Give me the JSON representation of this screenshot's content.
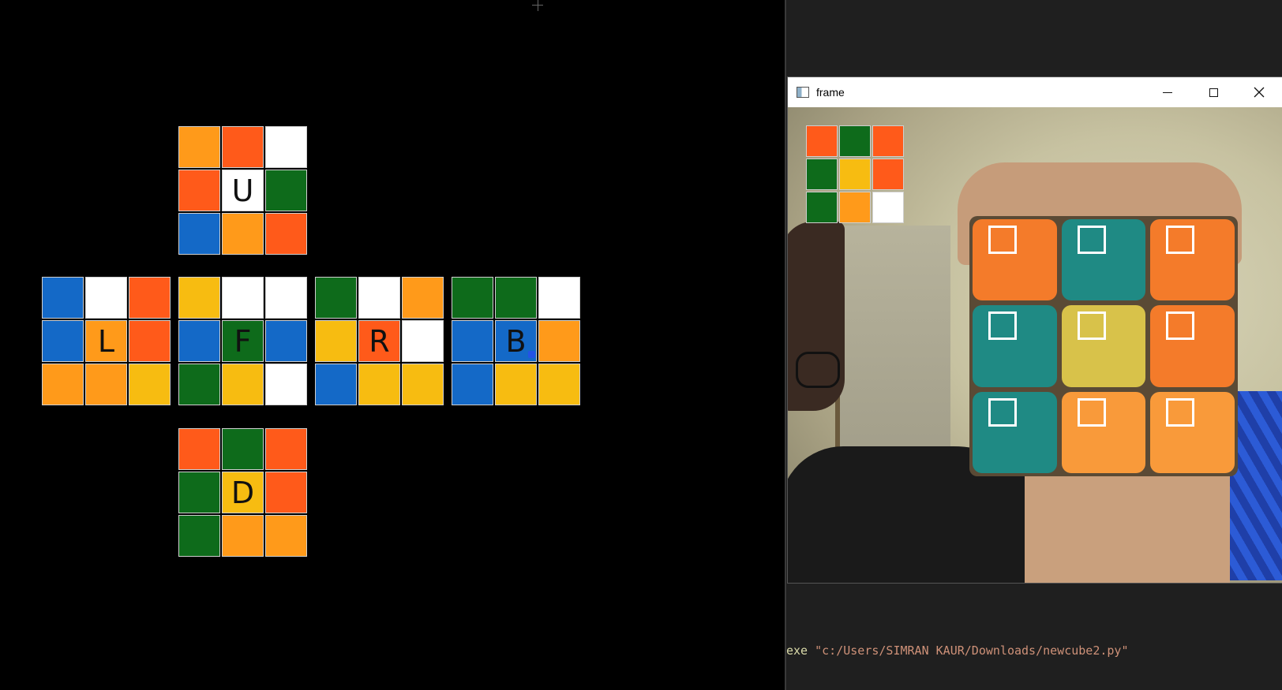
{
  "colors": {
    "orange": "#FF9A1A",
    "red": "#FF5A1A",
    "white": "#FFFFFF",
    "green": "#0E6B1B",
    "blue": "#1469C7",
    "yellow": "#F7BC11",
    "teal": "#1F8A84",
    "cube_orange": "#F47B2A",
    "cube_yellow": "#D8C24A",
    "cube_light_orange": "#F99A3A"
  },
  "net": {
    "faces": [
      {
        "id": "U",
        "letter": "U",
        "stickers": [
          "orange",
          "red",
          "white",
          "red",
          "white",
          "green",
          "blue",
          "orange",
          "red"
        ]
      },
      {
        "id": "L",
        "letter": "L",
        "stickers": [
          "blue",
          "white",
          "red",
          "blue",
          "orange",
          "red",
          "orange",
          "orange",
          "yellow"
        ]
      },
      {
        "id": "F",
        "letter": "F",
        "stickers": [
          "yellow",
          "white",
          "white",
          "blue",
          "green",
          "blue",
          "green",
          "yellow",
          "white"
        ]
      },
      {
        "id": "R",
        "letter": "R",
        "stickers": [
          "green",
          "white",
          "orange",
          "yellow",
          "red",
          "white",
          "blue",
          "yellow",
          "yellow"
        ]
      },
      {
        "id": "B",
        "letter": "B",
        "stickers": [
          "green",
          "green",
          "white",
          "blue",
          "blue",
          "orange",
          "blue",
          "yellow",
          "yellow"
        ]
      },
      {
        "id": "D",
        "letter": "D",
        "stickers": [
          "red",
          "green",
          "red",
          "green",
          "yellow",
          "red",
          "green",
          "orange",
          "orange"
        ]
      }
    ]
  },
  "frame_window": {
    "title": "frame",
    "icons": {
      "app": "opencv-window-icon",
      "minimize": "minimize-icon",
      "maximize": "maximize-icon",
      "close": "close-icon"
    },
    "preview_grid": [
      "red",
      "green",
      "red",
      "green",
      "yellow",
      "red",
      "green",
      "orange",
      "white"
    ],
    "cube_faces": [
      "cube_orange",
      "teal",
      "cube_orange",
      "teal",
      "cube_yellow",
      "cube_orange",
      "teal",
      "cube_light_orange",
      "cube_light_orange"
    ]
  },
  "terminal": {
    "exe": "exe",
    "path": "\"c:/Users/SIMRAN KAUR/Downloads/newcube2.py\""
  }
}
